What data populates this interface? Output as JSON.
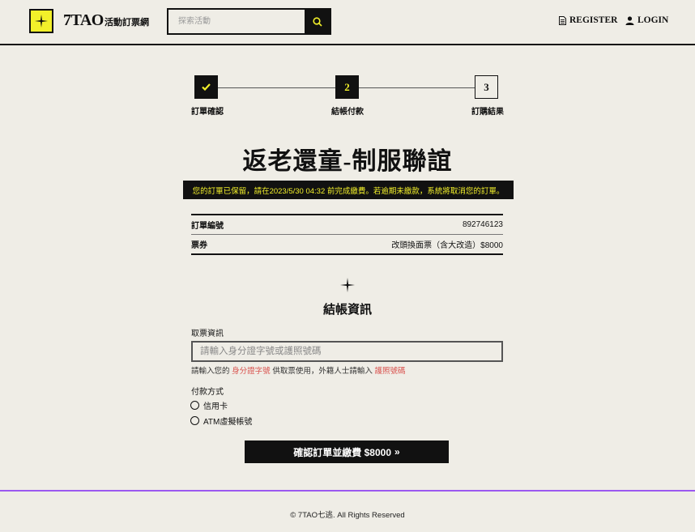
{
  "header": {
    "logo_text": "7TAO",
    "logo_sub": "活動訂票網",
    "search_placeholder": "探索活動",
    "register_label": "REGISTER",
    "login_label": "LOGIN"
  },
  "stepper": {
    "steps": [
      {
        "number": "✔",
        "label": "訂單確認",
        "state": "done"
      },
      {
        "number": "2",
        "label": "結帳付款",
        "state": "active"
      },
      {
        "number": "3",
        "label": "訂購結果",
        "state": "todo"
      }
    ]
  },
  "event": {
    "title": "返老還童-制服聯誼",
    "notice": "您的訂單已保留，請在2023/5/30 04:32 前完成繳費。若逾期未繳款，系統將取消您的訂單。"
  },
  "order": {
    "rows": [
      {
        "key": "訂單編號",
        "value": "892746123"
      },
      {
        "key": "票券",
        "value": "改頭換面票（含大改造）$8000"
      }
    ]
  },
  "checkout": {
    "title": "結帳資訊",
    "ticket_label": "取票資訊",
    "ticket_placeholder": "請輸入身分證字號或護照號碼",
    "hint_prefix": "請輸入您的",
    "hint_id": "身分證字號",
    "hint_middle": "供取票使用，外籍人士請輸入",
    "hint_passport": "護照號碼",
    "payment_label": "付款方式",
    "payment_options": [
      "信用卡",
      "ATM虛擬帳號"
    ],
    "confirm_label": "確認訂單並繳費 $8000",
    "confirm_icon": "»"
  },
  "footer": {
    "text": "© 7TAO七逃. All Rights Reserved"
  },
  "colors": {
    "background": "#efede6",
    "accent_yellow": "#f2f02a",
    "footer_purple": "#9b59f0",
    "hint_red": "#d9534f"
  },
  "icons": {
    "logo": "sparkle-icon",
    "search": "search-icon",
    "register": "document-icon",
    "login": "user-icon",
    "step_done": "check-icon",
    "section": "sparkle-icon"
  }
}
